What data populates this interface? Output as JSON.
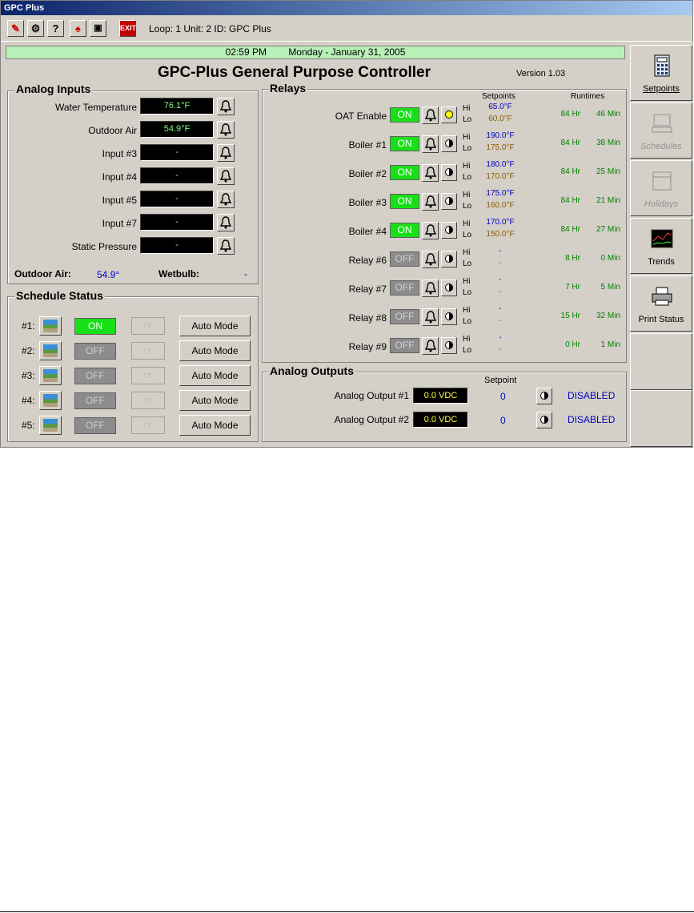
{
  "window_title": "GPC Plus",
  "toolbar": {
    "info": "Loop: 1  Unit: 2  ID: GPC Plus",
    "exit_label": "EXIT",
    "help_label": "?",
    "icons": [
      "tools-icon",
      "network-icon",
      "help-icon",
      "alarm-icon",
      "door-icon",
      "exit-icon"
    ]
  },
  "date_bar": {
    "time": "02:59 PM",
    "date": "Monday - January 31, 2005"
  },
  "title": "GPC-Plus General Purpose Controller",
  "version": "Version 1.03",
  "analog_inputs": {
    "title": "Analog Inputs",
    "items": [
      {
        "label": "Water Temperature",
        "value": "76.1°F"
      },
      {
        "label": "Outdoor Air",
        "value": "54.9°F"
      },
      {
        "label": "Input #3",
        "value": "-"
      },
      {
        "label": "Input #4",
        "value": "-"
      },
      {
        "label": "Input #5",
        "value": "-"
      },
      {
        "label": "Input #7",
        "value": "-"
      },
      {
        "label": "Static Pressure",
        "value": "-"
      }
    ],
    "outdoor_air_label": "Outdoor Air:",
    "outdoor_air_value": "54.9°",
    "wetbulb_label": "Wetbulb:",
    "wetbulb_value": "-"
  },
  "schedule_status": {
    "title": "Schedule Status",
    "items": [
      {
        "label": "#1:",
        "state": "ON",
        "mode": "Auto Mode"
      },
      {
        "label": "#2:",
        "state": "OFF",
        "mode": "Auto Mode"
      },
      {
        "label": "#3:",
        "state": "OFF",
        "mode": "Auto Mode"
      },
      {
        "label": "#4:",
        "state": "OFF",
        "mode": "Auto Mode"
      },
      {
        "label": "#5:",
        "state": "OFF",
        "mode": "Auto Mode"
      }
    ]
  },
  "relays": {
    "title": "Relays",
    "setpoints_header": "Setpoints",
    "runtimes_header": "Runtimes",
    "hi_label": "Hi",
    "lo_label": "Lo",
    "items": [
      {
        "label": "OAT Enable",
        "state": "ON",
        "hi": "65.0°F",
        "lo": "60.0°F",
        "hours": "84 Hr",
        "mins": "46 Min"
      },
      {
        "label": "Boiler #1",
        "state": "ON",
        "hi": "190.0°F",
        "lo": "175.0°F",
        "hours": "84 Hr",
        "mins": "38 Min"
      },
      {
        "label": "Boiler #2",
        "state": "ON",
        "hi": "180.0°F",
        "lo": "170.0°F",
        "hours": "84 Hr",
        "mins": "25 Min"
      },
      {
        "label": "Boiler #3",
        "state": "ON",
        "hi": "175.0°F",
        "lo": "160.0°F",
        "hours": "84 Hr",
        "mins": "21 Min"
      },
      {
        "label": "Boiler #4",
        "state": "ON",
        "hi": "170.0°F",
        "lo": "150.0°F",
        "hours": "84 Hr",
        "mins": "27 Min"
      },
      {
        "label": "Relay #6",
        "state": "OFF",
        "hi": "-",
        "lo": "-",
        "hours": "8 Hr",
        "mins": "0 Min"
      },
      {
        "label": "Relay #7",
        "state": "OFF",
        "hi": "-",
        "lo": "-",
        "hours": "7 Hr",
        "mins": "5 Min"
      },
      {
        "label": "Relay #8",
        "state": "OFF",
        "hi": "-",
        "lo": "-",
        "hours": "15 Hr",
        "mins": "32 Min"
      },
      {
        "label": "Relay #9",
        "state": "OFF",
        "hi": "-",
        "lo": "-",
        "hours": "0 Hr",
        "mins": "1 Min"
      }
    ]
  },
  "analog_outputs": {
    "title": "Analog Outputs",
    "setpoint_header": "Setpoint",
    "items": [
      {
        "label": "Analog Output #1",
        "value": "0.0 VDC",
        "setpoint": "0",
        "status": "DISABLED"
      },
      {
        "label": "Analog Output #2",
        "value": "0.0 VDC",
        "setpoint": "0",
        "status": "DISABLED"
      }
    ]
  },
  "sidebar": {
    "items": [
      {
        "label": "Setpoints",
        "icon": "calculator-icon",
        "enabled": true
      },
      {
        "label": "Schedules",
        "icon": "computer-icon",
        "enabled": false
      },
      {
        "label": "Holidays",
        "icon": "calendar-icon",
        "enabled": false
      },
      {
        "label": "Trends",
        "icon": "trend-chart-icon",
        "enabled": true
      },
      {
        "label": "Print Status",
        "icon": "printer-icon",
        "enabled": true
      }
    ]
  },
  "colors": {
    "on": "#18e018",
    "off": "#8c8c8c",
    "date_bar": "#b8f0b8",
    "setpoint_hi": "#0000c0",
    "setpoint_lo": "#8b5a00",
    "runtime": "#008000",
    "display_text": "#7cff7c"
  }
}
